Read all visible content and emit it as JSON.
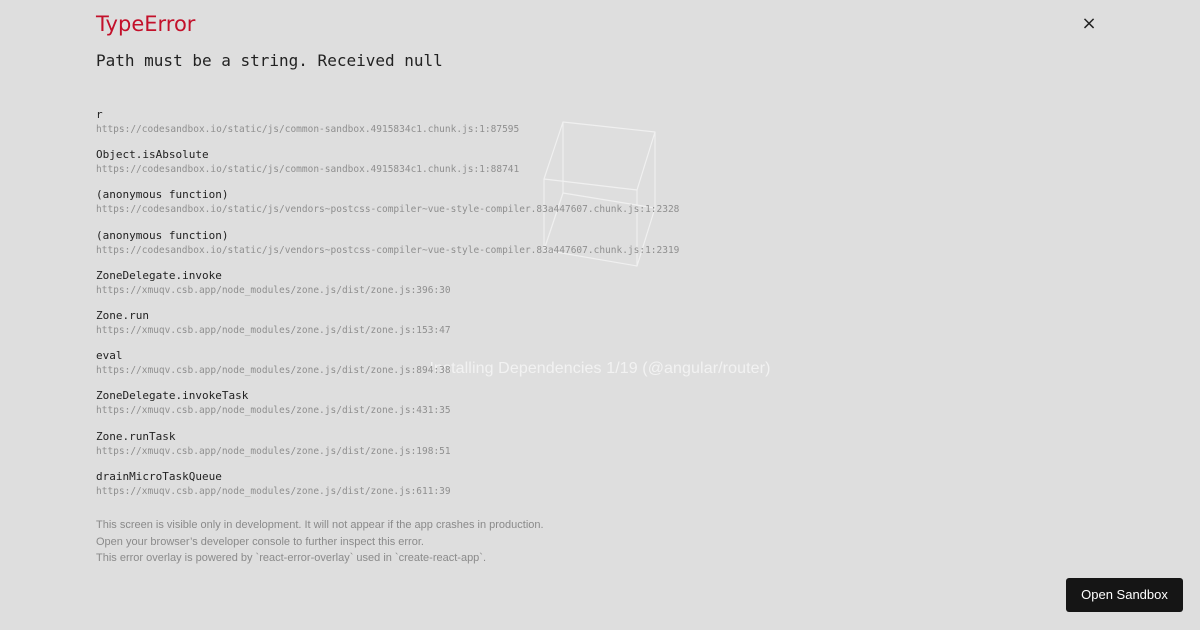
{
  "background": {
    "loading_text": "Installing Dependencies 1/19 (@angular/router)"
  },
  "error": {
    "title": "TypeError",
    "message": "Path must be a string. Received null",
    "close_label": "×",
    "stack": [
      {
        "fn": "r",
        "loc": "https://codesandbox.io/static/js/common-sandbox.4915834c1.chunk.js:1:87595"
      },
      {
        "fn": "Object.isAbsolute",
        "loc": "https://codesandbox.io/static/js/common-sandbox.4915834c1.chunk.js:1:88741"
      },
      {
        "fn": "(anonymous function)",
        "loc": "https://codesandbox.io/static/js/vendors~postcss-compiler~vue-style-compiler.83a447607.chunk.js:1:2328"
      },
      {
        "fn": "(anonymous function)",
        "loc": "https://codesandbox.io/static/js/vendors~postcss-compiler~vue-style-compiler.83a447607.chunk.js:1:2319"
      },
      {
        "fn": "ZoneDelegate.invoke",
        "loc": "https://xmuqv.csb.app/node_modules/zone.js/dist/zone.js:396:30"
      },
      {
        "fn": "Zone.run",
        "loc": "https://xmuqv.csb.app/node_modules/zone.js/dist/zone.js:153:47"
      },
      {
        "fn": "eval",
        "loc": "https://xmuqv.csb.app/node_modules/zone.js/dist/zone.js:894:38"
      },
      {
        "fn": "ZoneDelegate.invokeTask",
        "loc": "https://xmuqv.csb.app/node_modules/zone.js/dist/zone.js:431:35"
      },
      {
        "fn": "Zone.runTask",
        "loc": "https://xmuqv.csb.app/node_modules/zone.js/dist/zone.js:198:51"
      },
      {
        "fn": "drainMicroTaskQueue",
        "loc": "https://xmuqv.csb.app/node_modules/zone.js/dist/zone.js:611:39"
      }
    ],
    "footer": [
      "This screen is visible only in development. It will not appear if the app crashes in production.",
      "Open your browser’s developer console to further inspect this error.",
      "This error overlay is powered by `react-error-overlay` used in `create-react-app`."
    ]
  },
  "actions": {
    "open_sandbox_label": "Open Sandbox"
  },
  "colors": {
    "background": "#dedede",
    "error_title": "#c3102a",
    "button_bg": "#151515"
  }
}
